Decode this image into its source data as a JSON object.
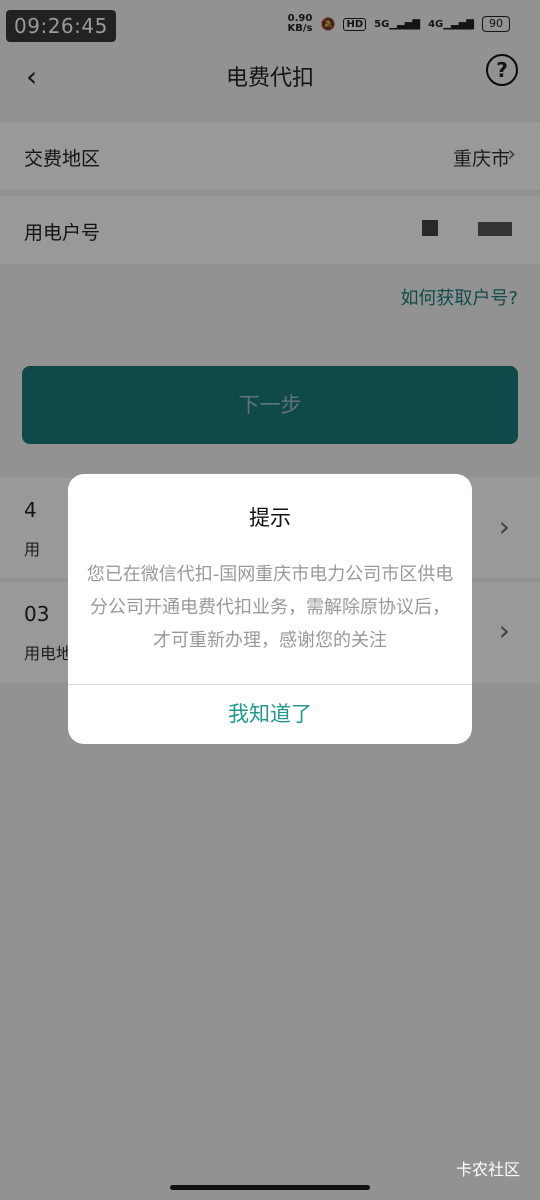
{
  "status_bar": {
    "time": "09:26:45",
    "net_speed_value": "0.90",
    "net_speed_unit": "KB/s",
    "hd_label": "HD",
    "signal_1": "5G",
    "signal_2": "4G",
    "battery": "90"
  },
  "nav": {
    "title": "电费代扣",
    "help_symbol": "?"
  },
  "form": {
    "region_label": "交费地区",
    "region_value": "重庆市",
    "account_label": "用电户号"
  },
  "howto_link": "如何获取户号?",
  "next_button": "下一步",
  "history": [
    {
      "line1": "4",
      "line2": "用"
    },
    {
      "line1": "03",
      "line2": "用电地"
    }
  ],
  "dialog": {
    "title": "提示",
    "message": "您已在微信代扣-国网重庆市电力公司市区供电分公司开通电费代扣业务，需解除原协议后，才可重新办理，感谢您的关注",
    "confirm": "我知道了"
  },
  "watermark": "卡农社区",
  "colors": {
    "accent": "#1a7a7a",
    "dialog_button": "#1f9a8e",
    "link": "#1f7d7d"
  }
}
